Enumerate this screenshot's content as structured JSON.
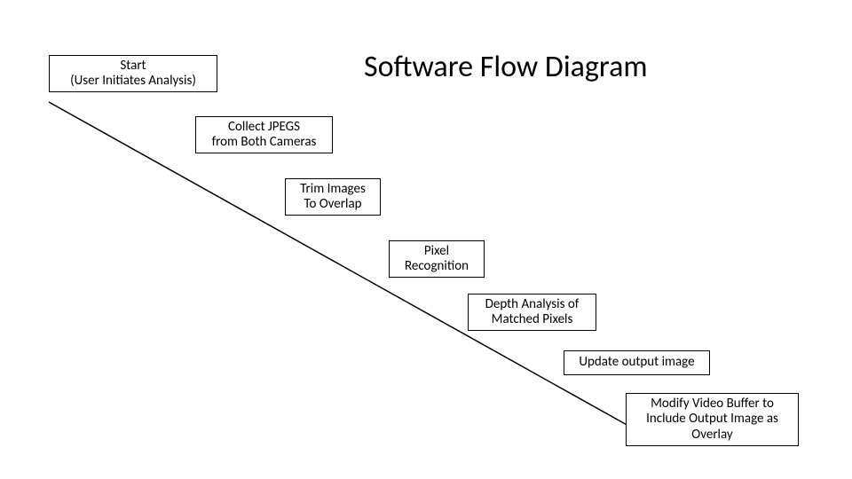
{
  "title": "Software Flow Diagram",
  "steps": {
    "start": {
      "line1": "Start",
      "line2": "(User Initiates Analysis)"
    },
    "collect": {
      "line1": "Collect JPEGS",
      "line2": "from Both Cameras"
    },
    "trim": {
      "line1": "Trim Images",
      "line2": "To Overlap"
    },
    "pixel": {
      "line1": "Pixel",
      "line2": "Recognition"
    },
    "depth": {
      "line1": "Depth Analysis of",
      "line2": "Matched Pixels"
    },
    "update": {
      "line1": "Update output image"
    },
    "modify": {
      "line1": "Modify Video Buffer to",
      "line2": "Include Output Image as",
      "line3": "Overlay"
    }
  }
}
